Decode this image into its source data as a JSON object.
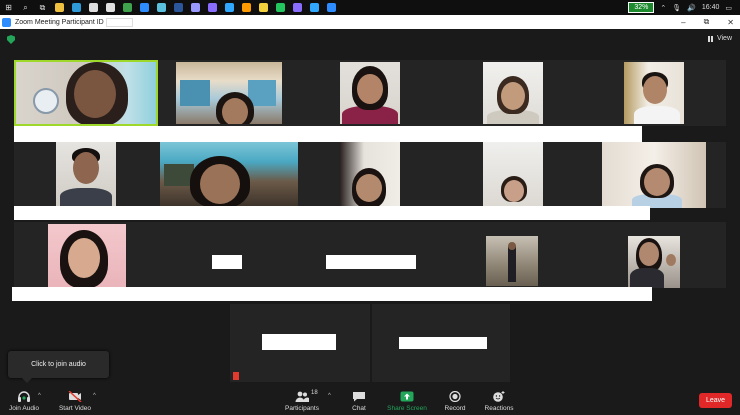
{
  "taskbar": {
    "battery": "32%",
    "time": "16:40",
    "apps": [
      {
        "icon": "folder-icon",
        "color": "#f0c040"
      },
      {
        "icon": "edge-icon",
        "color": "#2e9ad8"
      },
      {
        "icon": "store-icon",
        "color": "#ddd"
      },
      {
        "icon": "shield-app-icon",
        "color": "#e0e0e0"
      },
      {
        "icon": "chrome-icon",
        "color": "#3fa34d"
      },
      {
        "icon": "arrow-app-icon",
        "color": "#2d8cff"
      },
      {
        "icon": "cursor-app-icon",
        "color": "#5bc0de"
      },
      {
        "icon": "word-icon",
        "color": "#2b579a"
      },
      {
        "icon": "after-effects-icon",
        "color": "#9999ff"
      },
      {
        "icon": "premiere-icon",
        "color": "#8a6cff"
      },
      {
        "icon": "photoshop-icon",
        "color": "#31a8ff"
      },
      {
        "icon": "illustrator-icon",
        "color": "#ff9a00"
      },
      {
        "icon": "notes-icon",
        "color": "#f3d23b"
      },
      {
        "icon": "green-app-icon",
        "color": "#22c55e"
      },
      {
        "icon": "pr-alt-icon",
        "color": "#8a6cff"
      },
      {
        "icon": "photoshop-alt-icon",
        "color": "#31a8ff"
      },
      {
        "icon": "zoom-app-icon",
        "color": "#2d8cff"
      }
    ]
  },
  "window": {
    "title": "Zoom Meeting Participant ID"
  },
  "meeting": {
    "view_label": "View"
  },
  "tooltip": {
    "join_audio": "Click to join audio"
  },
  "toolbar": {
    "join_audio": "Join Audio",
    "start_video": "Start Video",
    "participants": "Participants",
    "participant_count": "18",
    "chat": "Chat",
    "share_screen": "Share Screen",
    "record": "Record",
    "reactions": "Reactions",
    "leave": "Leave"
  },
  "colors": {
    "active_speaker": "#9dd82a",
    "share_screen": "#23a55a",
    "leave": "#e02828",
    "zoom_blue": "#2d8cff"
  }
}
